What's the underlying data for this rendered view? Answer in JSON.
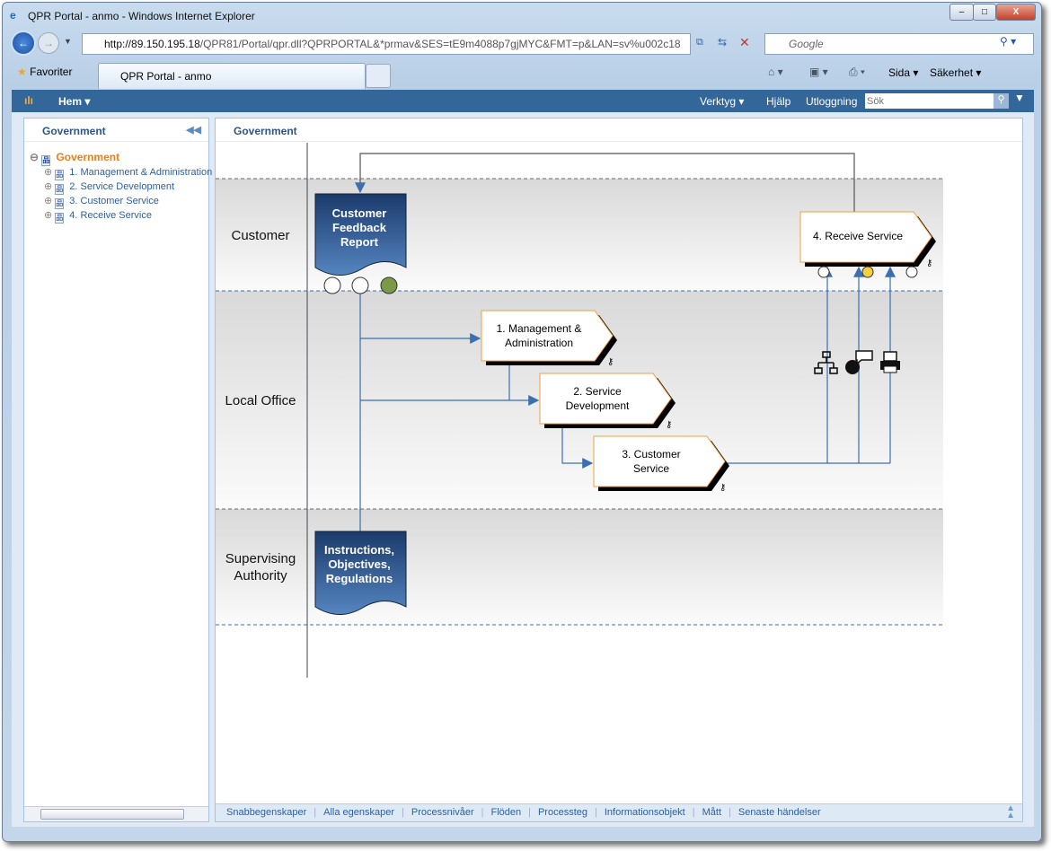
{
  "window": {
    "title": "QPR Portal - anmo - Windows Internet Explorer"
  },
  "browser": {
    "url_host": "http://89.150.195.18",
    "url_rest": "/QPR81/Portal/qpr.dll?QPRPORTAL&*prmav&SES=tE9m4088p7gjMYC&FMT=p&LAN=sv%u002c18",
    "search_placeholder": "Google",
    "favorites": "Favoriter",
    "tab_title": "QPR Portal - anmo",
    "cmd_page": "Sida",
    "cmd_safety": "Säkerhet"
  },
  "portal": {
    "home": "Hem",
    "tools": "Verktyg",
    "help": "Hjälp",
    "logout": "Utloggning",
    "search_placeholder": "Sök"
  },
  "left": {
    "header": "Government",
    "root": "Government",
    "items": [
      "1. Management & Administration",
      "2. Service Development",
      "3. Customer Service",
      "4. Receive Service"
    ]
  },
  "main": {
    "header": "Government"
  },
  "diagram": {
    "lanes": [
      "Customer",
      "Local Office",
      "Supervising Authority"
    ],
    "documents": [
      "Customer Feedback Report",
      "Instructions, Objectives, Regulations"
    ],
    "processes": [
      "1. Management & Administration",
      "2. Service Development",
      "3. Customer Service",
      "4. Receive Service"
    ],
    "colors": {
      "document": "#2a5288",
      "process_border": "#f0a040",
      "indicator_green": "#7a9a4a",
      "indicator_yellow": "#f5d040",
      "line": "#3b6fb0"
    }
  },
  "footer": [
    "Snabbegenskaper",
    "Alla egenskaper",
    "Processnivåer",
    "Flöden",
    "Processteg",
    "Informationsobjekt",
    "Mått",
    "Senaste händelser"
  ]
}
